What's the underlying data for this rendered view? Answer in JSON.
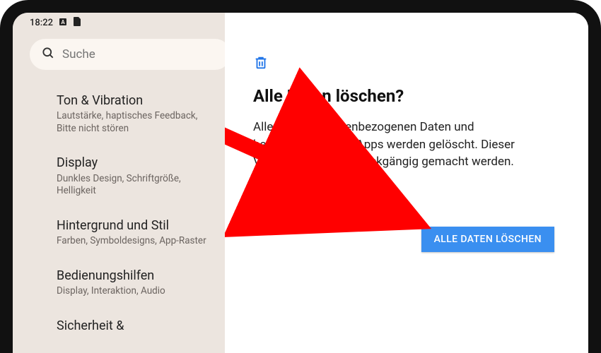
{
  "statusbar": {
    "time": "18:22"
  },
  "search": {
    "placeholder": "Suche"
  },
  "sidebar": {
    "items": [
      {
        "title": "Ton & Vibration",
        "subtitle": "Lautstärke, haptisches Feedback, Bitte nicht stören"
      },
      {
        "title": "Display",
        "subtitle": "Dunkles Design, Schriftgröße, Helligkeit"
      },
      {
        "title": "Hintergrund und Stil",
        "subtitle": "Farben, Symboldesigns, App-Raster"
      },
      {
        "title": "Bedienungshilfen",
        "subtitle": "Display, Interaktion, Audio"
      },
      {
        "title": "Sicherheit &",
        "subtitle": ""
      }
    ]
  },
  "main": {
    "title": "Alle Daten löschen?",
    "description": "Alle deine personenbezogenen Daten und heruntergeladenen Apps werden gelöscht. Dieser Vorgang kann nicht rückgängig gemacht werden.",
    "confirm_button": "ALLE DATEN LÖSCHEN"
  },
  "colors": {
    "accent": "#3a8ff0",
    "arrow": "#ff0000"
  }
}
